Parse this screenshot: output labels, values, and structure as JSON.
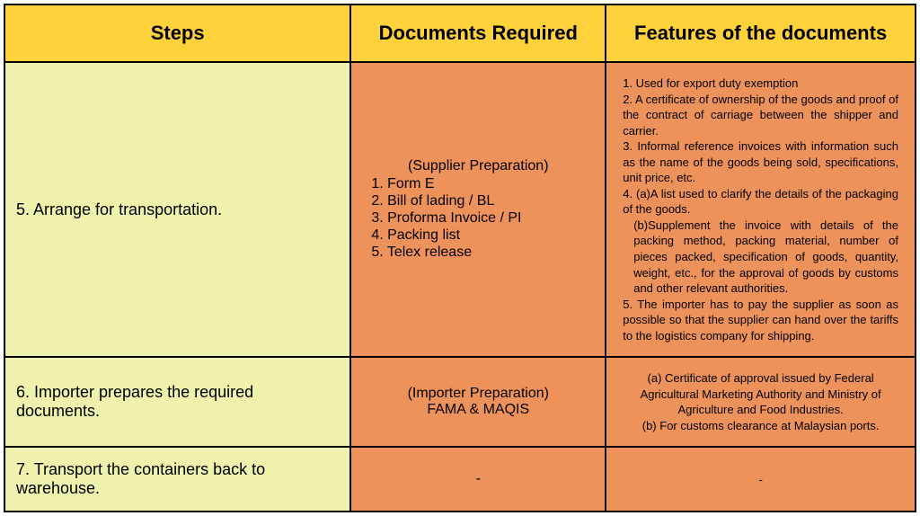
{
  "headers": {
    "steps": "Steps",
    "docs": "Documents Required",
    "feat": "Features of the documents"
  },
  "rows": {
    "r5": {
      "step": "5. Arrange for transportation.",
      "docs_note": "(Supplier Preparation)",
      "docs": {
        "d1": "1. Form E",
        "d2": "2. Bill of lading / BL",
        "d3": "3. Proforma Invoice / PI",
        "d4": "4. Packing list",
        "d5": "5. Telex release"
      },
      "feat": {
        "f1": "1. Used for export duty exemption",
        "f2": "2. A certificate of ownership of the goods and proof of the contract of carriage between the shipper and carrier.",
        "f3": "3. Informal reference invoices with information such as the name of the goods being sold, specifications, unit price, etc.",
        "f4a": "4. (a)A list used to clarify the details of the packaging of the goods.",
        "f4b": "(b)Supplement the invoice with details of the packing method, packing material, number of pieces packed, specification of goods, quantity, weight, etc., for the approval of goods by customs and other relevant authorities.",
        "f5": "5. The importer has to pay the supplier as soon as possible so that the supplier can hand over the tariffs to the logistics company for shipping."
      }
    },
    "r6": {
      "step": " 6. Importer prepares the required documents.",
      "docs_note": "(Importer Preparation)",
      "docs_line": "FAMA & MAQIS",
      "feat": {
        "a": "(a) Certificate of approval issued by Federal Agricultural Marketing Authority and Ministry of Agriculture and Food Industries.",
        "b": "(b) For customs clearance at Malaysian ports."
      }
    },
    "r7": {
      "step": "7. Transport the containers back to warehouse.",
      "docs_line": "-",
      "feat_line": "-"
    }
  }
}
